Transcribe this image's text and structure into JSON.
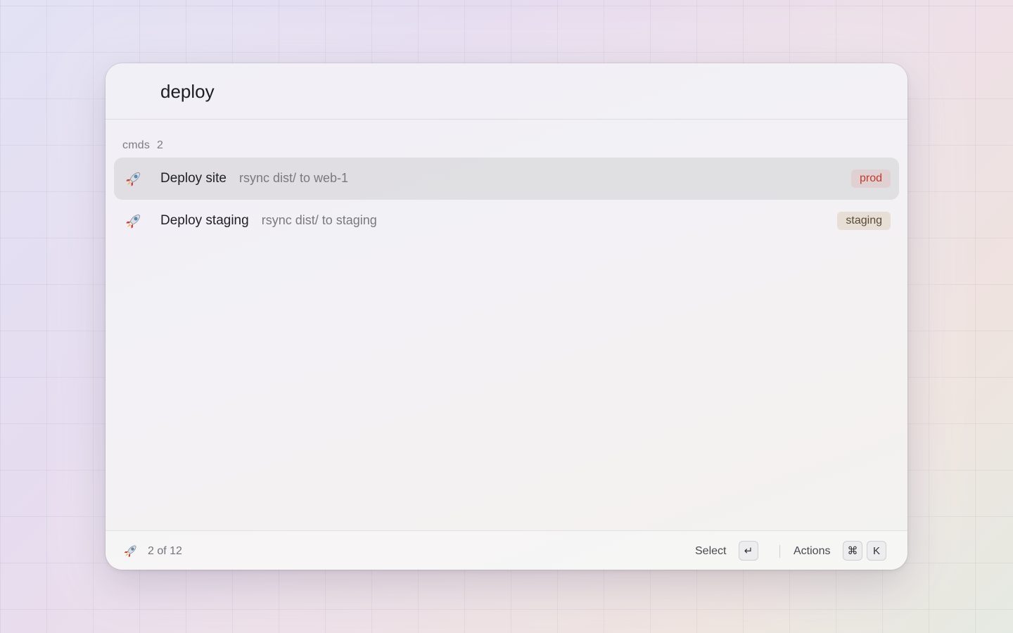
{
  "search": {
    "value": "deploy"
  },
  "section": {
    "label": "cmds",
    "count": "2"
  },
  "results": [
    {
      "icon": "rocket-icon",
      "title": "Deploy site",
      "subtitle": "rsync dist/ to web-1",
      "tag": "prod",
      "selected": true
    },
    {
      "icon": "rocket-icon",
      "title": "Deploy staging",
      "subtitle": "rsync dist/ to staging",
      "tag": "staging",
      "selected": false
    }
  ],
  "footer": {
    "icon": "rocket-icon",
    "count": "2 of 12",
    "select_label": "Select",
    "select_key": "↵",
    "actions_label": "Actions",
    "actions_key_1": "⌘",
    "actions_key_2": "K"
  },
  "colors": {
    "tag_prod_text": "#c0392b",
    "tag_staging_text": "#5a4a35"
  }
}
